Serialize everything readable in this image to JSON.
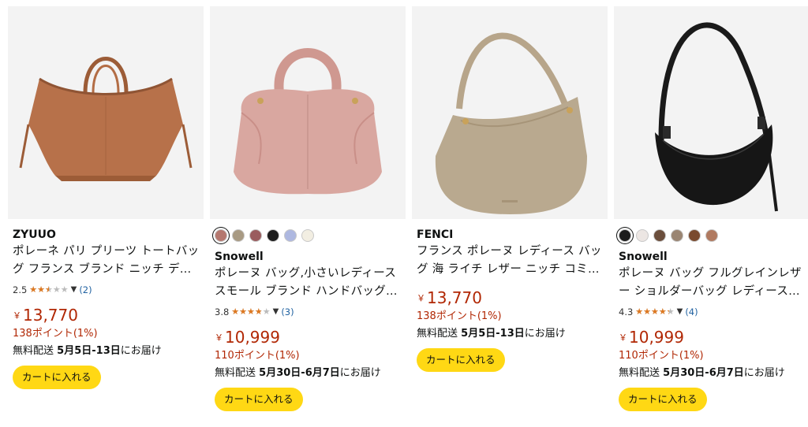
{
  "colors": {
    "price": "#b12704",
    "button": "#ffd814",
    "star": "#de7921",
    "link": "#2162a1",
    "tile_bg": "#f3f3f3"
  },
  "products": [
    {
      "image_icon": "tan-tote-bag-image",
      "swatches": [],
      "brand": "ZYUUO",
      "title": "ポレーネ パリ プリーツ トートバッグ フランス ブランド ニッチ デ…",
      "rating_text": "2.5",
      "rating_value": 2.5,
      "review_count": "(2)",
      "currency": "￥",
      "price": "13,770",
      "points": "138ポイント(1%)",
      "delivery_prefix": "無料配送",
      "delivery_dates": "5月5日-13日",
      "delivery_suffix": "にお届け",
      "cart_label": "カートに入れる"
    },
    {
      "image_icon": "pink-cloud-handbag-image",
      "swatches": [
        "#b5786f",
        "#a89a83",
        "#9a5c5e",
        "#1c1c1c",
        "#aeb8e0",
        "#f2eee2"
      ],
      "selected_swatch": 0,
      "brand": "Snowell",
      "title": "ポレーヌ バッグ,小さいレディース スモール ブランド ハンドバッグ…",
      "rating_text": "3.8",
      "rating_value": 3.8,
      "review_count": "(3)",
      "currency": "￥",
      "price": "10,999",
      "points": "110ポイント(1%)",
      "delivery_prefix": "無料配送",
      "delivery_dates": "5月30日-6月7日",
      "delivery_suffix": "にお届け",
      "cart_label": "カートに入れる"
    },
    {
      "image_icon": "taupe-shoulder-bag-image",
      "swatches": [],
      "brand": "FENCI",
      "title": "フランス ポレーヌ レディース バッグ 海 ライチ レザー ニッチ コミ…",
      "rating_text": "",
      "rating_value": null,
      "review_count": "",
      "currency": "￥",
      "price": "13,770",
      "points": "138ポイント(1%)",
      "delivery_prefix": "無料配送",
      "delivery_dates": "5月5日-13日",
      "delivery_suffix": "にお届け",
      "cart_label": "カートに入れる"
    },
    {
      "image_icon": "black-crescent-bag-image",
      "swatches": [
        "#1c1c1c",
        "#ece6e3",
        "#6b4e3c",
        "#9a8572",
        "#7a4a2e",
        "#b07a60"
      ],
      "selected_swatch": 0,
      "brand": "Snowell",
      "title": "ポレーヌ バッグ フルグレインレザー ショルダーバッグ レディース…",
      "rating_text": "4.3",
      "rating_value": 4.3,
      "review_count": "(4)",
      "currency": "￥",
      "price": "10,999",
      "points": "110ポイント(1%)",
      "delivery_prefix": "無料配送",
      "delivery_dates": "5月30日-6月7日",
      "delivery_suffix": "にお届け",
      "cart_label": "カートに入れる"
    }
  ]
}
